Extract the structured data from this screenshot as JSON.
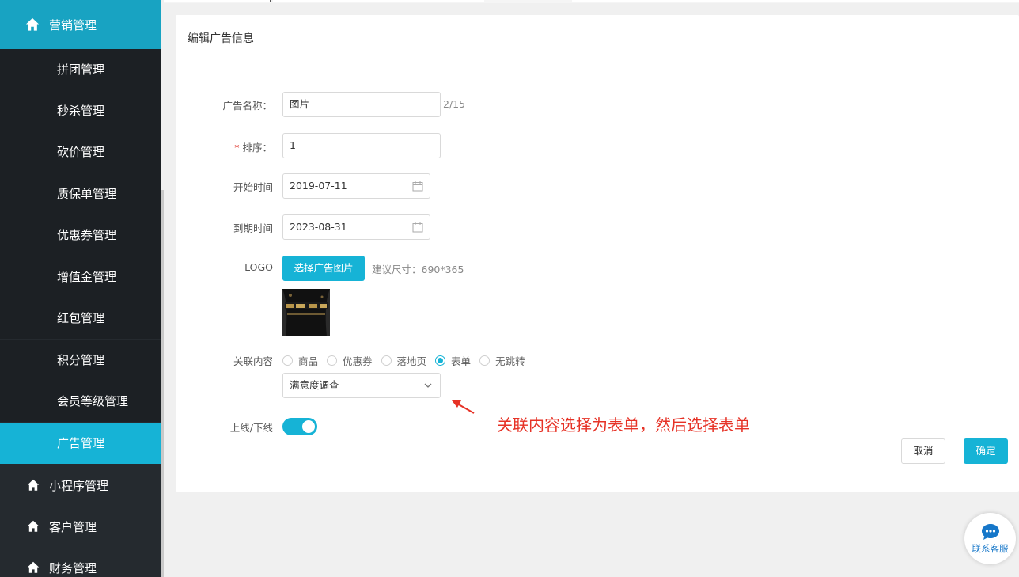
{
  "sidebar": {
    "active_parent": "营销管理",
    "sub_items": [
      "拼团管理",
      "秒杀管理",
      "砍价管理",
      "质保单管理",
      "优惠券管理",
      "增值金管理",
      "红包管理",
      "积分管理",
      "会员等级管理",
      "广告管理"
    ],
    "selected_sub_item": "广告管理",
    "other_parents": [
      "小程序管理",
      "客户管理",
      "财务管理"
    ]
  },
  "card": {
    "title": "编辑广告信息"
  },
  "form": {
    "name_label": "广告名称：",
    "name_value": "图片",
    "name_count": "2/15",
    "sort_required_mark": "*",
    "sort_label": "排序：",
    "sort_value": "1",
    "start_label": "开始时间",
    "start_value": "2019-07-11",
    "end_label": "到期时间",
    "end_value": "2023-08-31",
    "logo_label": "LOGO",
    "logo_button": "选择广告图片",
    "logo_hint": "建议尺寸：690*365",
    "related_label": "关联内容",
    "related_options": [
      "商品",
      "优惠券",
      "落地页",
      "表单",
      "无跳转"
    ],
    "related_selected": "表单",
    "form_select_value": "满意度调查",
    "online_label": "上线/下线",
    "online_state": true,
    "cancel_button": "取消",
    "confirm_button": "确定"
  },
  "annotation": {
    "text": "关联内容选择为表单，然后选择表单"
  },
  "customer_service": {
    "label": "联系客服"
  },
  "colors": {
    "accent": "#16b3d6",
    "sidebar_bg": "#252a2f",
    "sidebar_active": "#18a3c2",
    "annotation": "#e63226"
  }
}
